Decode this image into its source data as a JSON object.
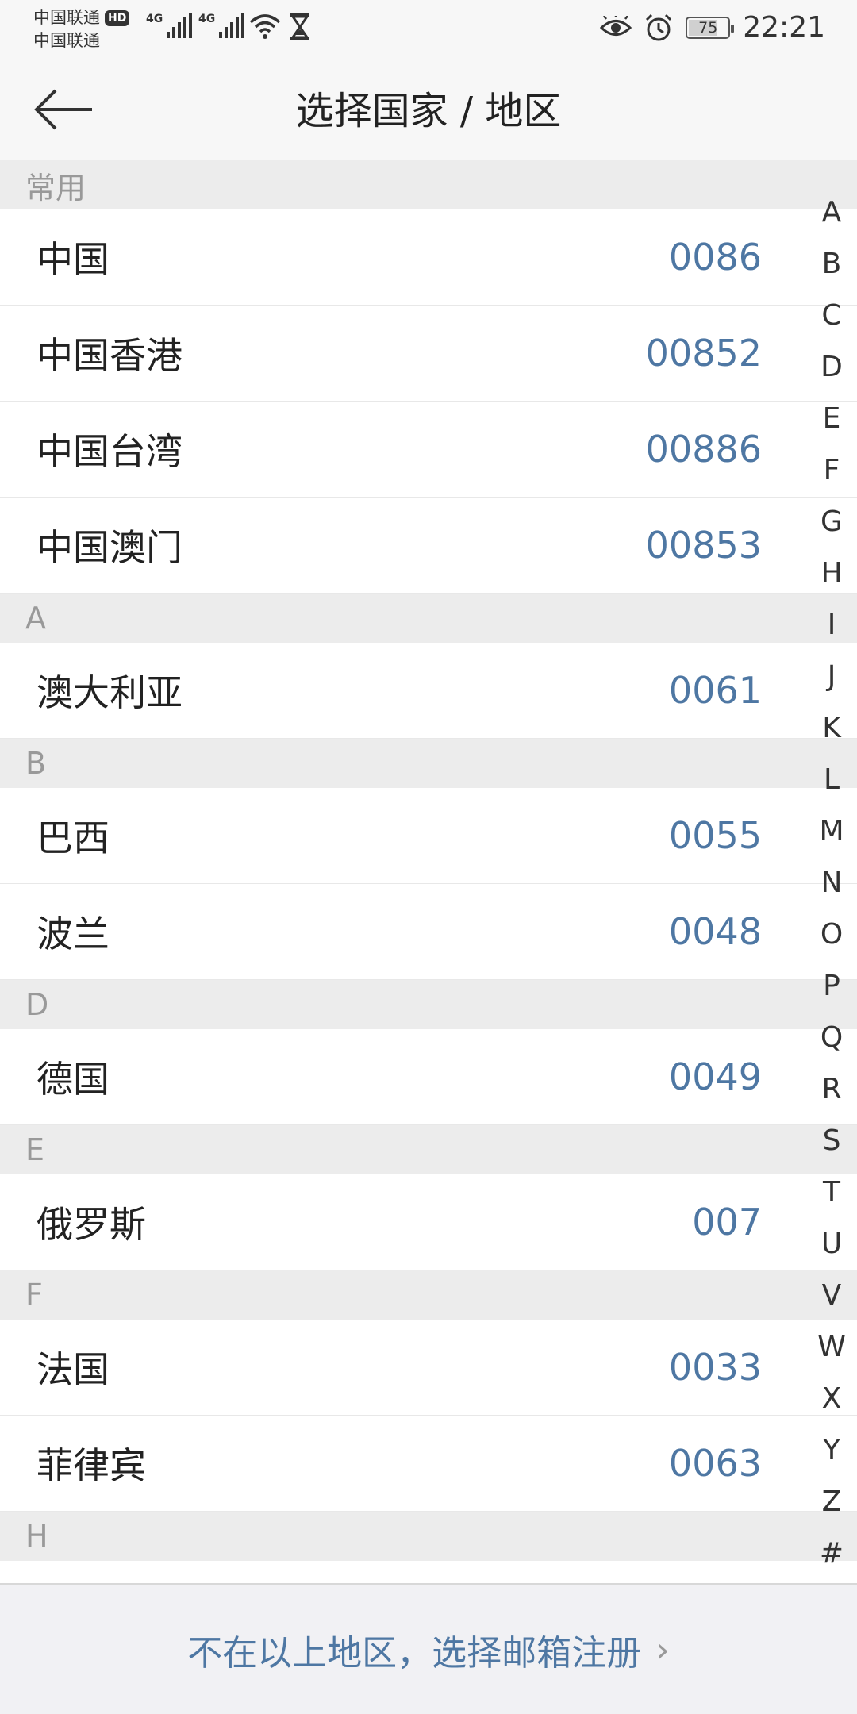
{
  "status_bar": {
    "carrier1": "中国联通",
    "hd": "HD",
    "carrier2": "中国联通",
    "net1": "4G",
    "net2": "4G",
    "battery": "75",
    "battery_level": 0.75,
    "time": "22:21"
  },
  "header": {
    "title": "选择国家 / 地区"
  },
  "sections": [
    {
      "header": "常用",
      "items": [
        {
          "name": "中国",
          "code": "0086"
        },
        {
          "name": "中国香港",
          "code": "00852"
        },
        {
          "name": "中国台湾",
          "code": "00886"
        },
        {
          "name": "中国澳门",
          "code": "00853"
        }
      ]
    },
    {
      "header": "A",
      "items": [
        {
          "name": "澳大利亚",
          "code": "0061"
        }
      ]
    },
    {
      "header": "B",
      "items": [
        {
          "name": "巴西",
          "code": "0055"
        },
        {
          "name": "波兰",
          "code": "0048"
        }
      ]
    },
    {
      "header": "D",
      "items": [
        {
          "name": "德国",
          "code": "0049"
        }
      ]
    },
    {
      "header": "E",
      "items": [
        {
          "name": "俄罗斯",
          "code": "007"
        }
      ]
    },
    {
      "header": "F",
      "items": [
        {
          "name": "法国",
          "code": "0033"
        },
        {
          "name": "菲律宾",
          "code": "0063"
        }
      ]
    },
    {
      "header": "H",
      "items": []
    }
  ],
  "index_letters": [
    "A",
    "B",
    "C",
    "D",
    "E",
    "F",
    "G",
    "H",
    "I",
    "J",
    "K",
    "L",
    "M",
    "N",
    "O",
    "P",
    "Q",
    "R",
    "S",
    "T",
    "U",
    "V",
    "W",
    "X",
    "Y",
    "Z",
    "#"
  ],
  "footer": {
    "link_label": "不在以上地区，选择邮箱注册"
  },
  "colors": {
    "accent": "#4e77a3",
    "section_bg": "#ececec",
    "section_text": "#999999"
  }
}
